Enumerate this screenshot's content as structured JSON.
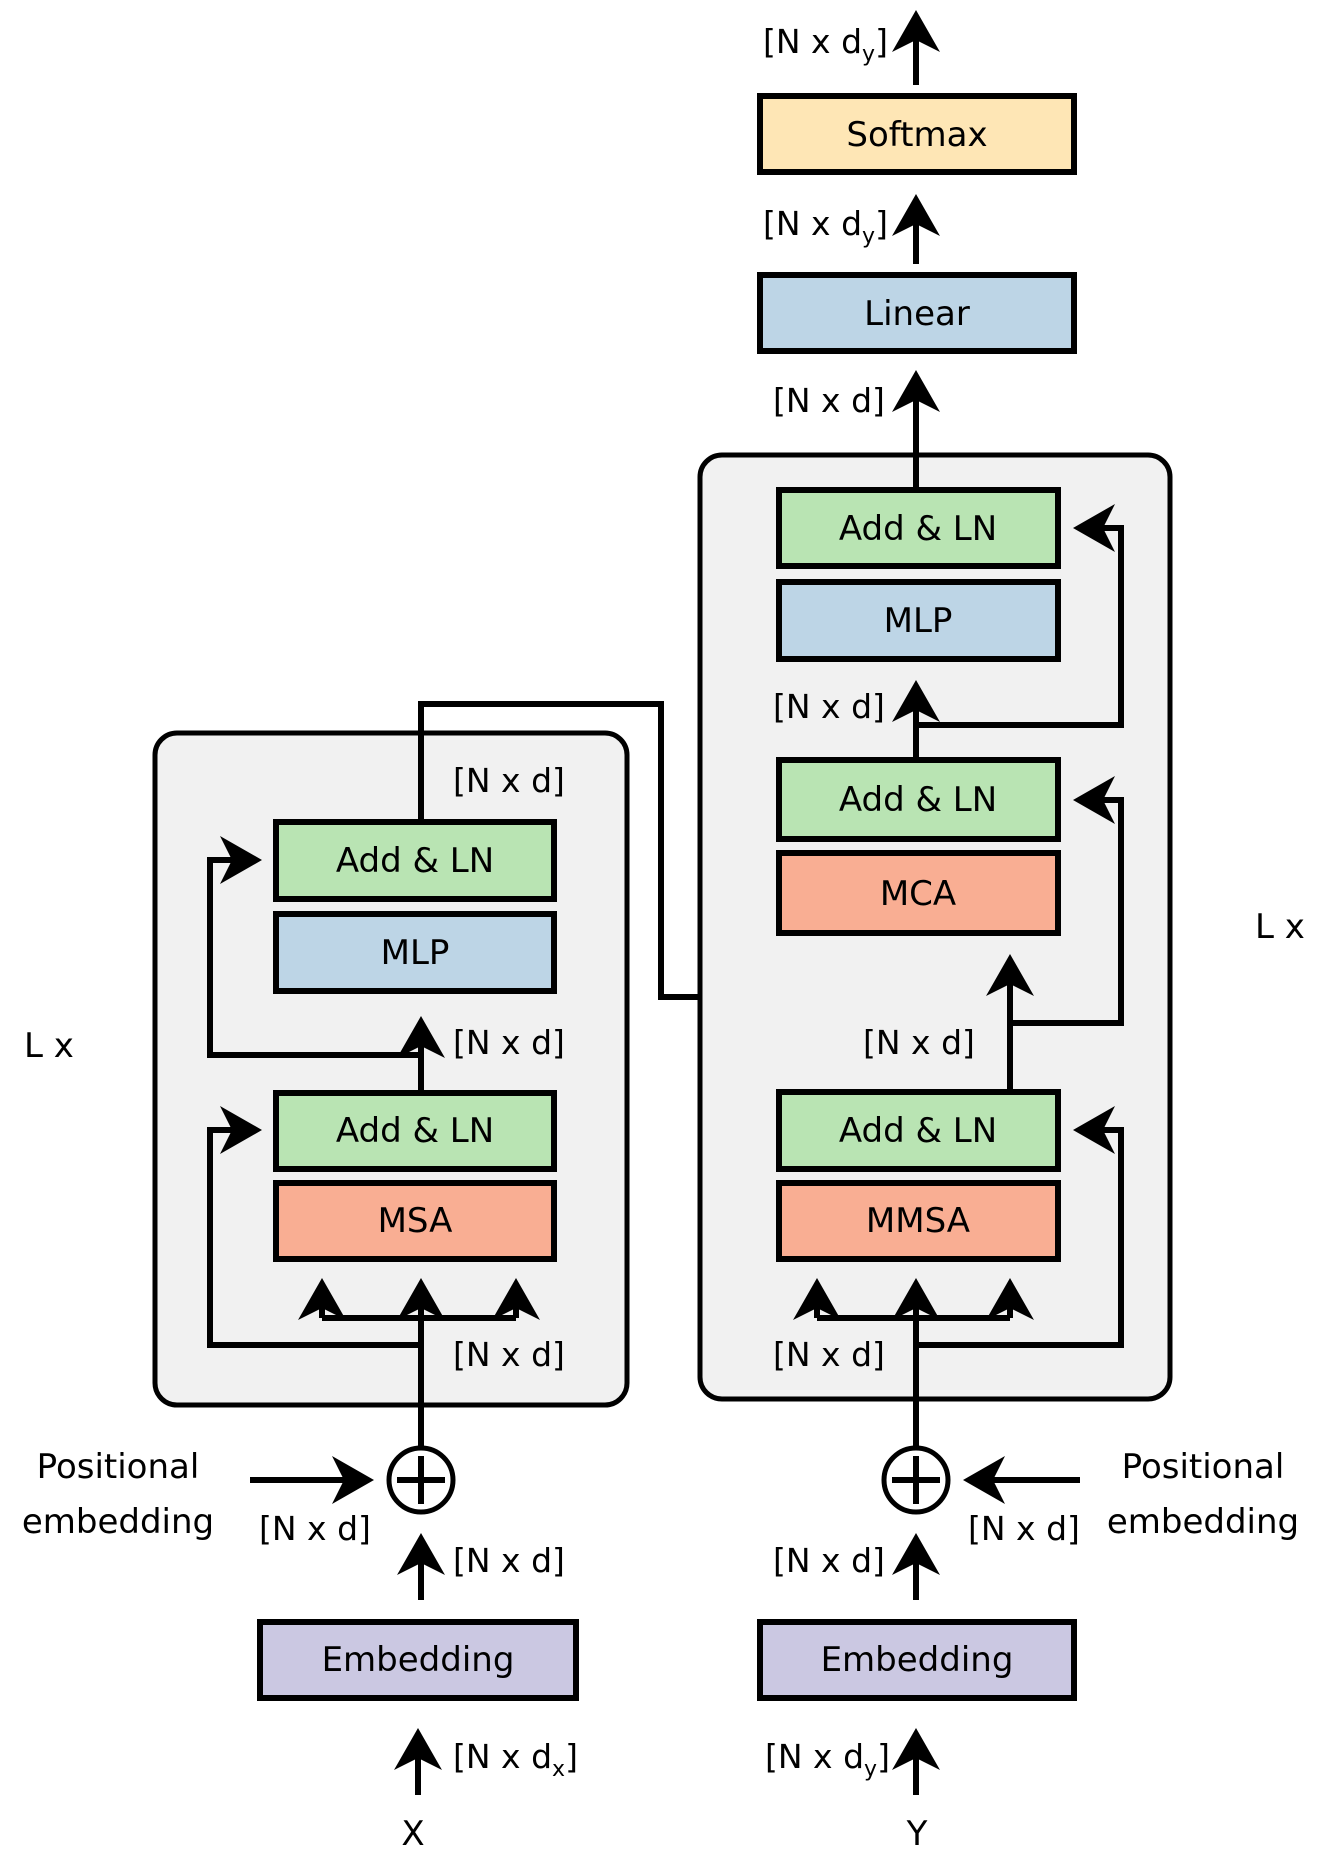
{
  "colors": {
    "add_ln": "#b9e4b3",
    "mlp": "#bdd5e6",
    "linear": "#bdd5e6",
    "attention": "#f9ae93",
    "softmax": "#fee6b5",
    "embedding": "#cbc8e2",
    "block_bg": "#f1f1f1"
  },
  "encoder": {
    "repeat_label": "L x",
    "input_label": "X",
    "input_dim": {
      "base": "[N x d",
      "sub": "x",
      "close": "]"
    },
    "embedding_label": "Embedding",
    "embedding_out_dim": "[N x d]",
    "positional_label_line1": "Positional",
    "positional_label_line2": "embedding",
    "positional_dim": "[N x d]",
    "attn_in_dim": "[N x d]",
    "attention_label": "MSA",
    "add_ln_1": "Add & LN",
    "mlp_in_dim": "[N x d]",
    "mlp_label": "MLP",
    "add_ln_2": "Add & LN",
    "output_dim": "[N x d]"
  },
  "decoder": {
    "repeat_label": "L x",
    "input_label": "Y",
    "input_dim": {
      "base": "[N x d",
      "sub": "y",
      "close": "]"
    },
    "embedding_label": "Embedding",
    "embedding_out_dim": "[N x d]",
    "positional_label_line1": "Positional",
    "positional_label_line2": "embedding",
    "positional_dim": "[N x d]",
    "attn_in_dim": "[N x d]",
    "masked_attention_label": "MMSA",
    "add_ln_1": "Add & LN",
    "cross_in_dim": "[N x d]",
    "cross_attention_label": "MCA",
    "add_ln_2": "Add & LN",
    "mlp_in_dim": "[N x d]",
    "mlp_label": "MLP",
    "add_ln_3": "Add & LN",
    "output_dim": "[N x d]"
  },
  "head": {
    "linear_label": "Linear",
    "linear_out_dim": {
      "base": "[N x d",
      "sub": "y",
      "close": "]"
    },
    "softmax_label": "Softmax",
    "softmax_out_dim": {
      "base": "[N x d",
      "sub": "y",
      "close": "]"
    }
  }
}
